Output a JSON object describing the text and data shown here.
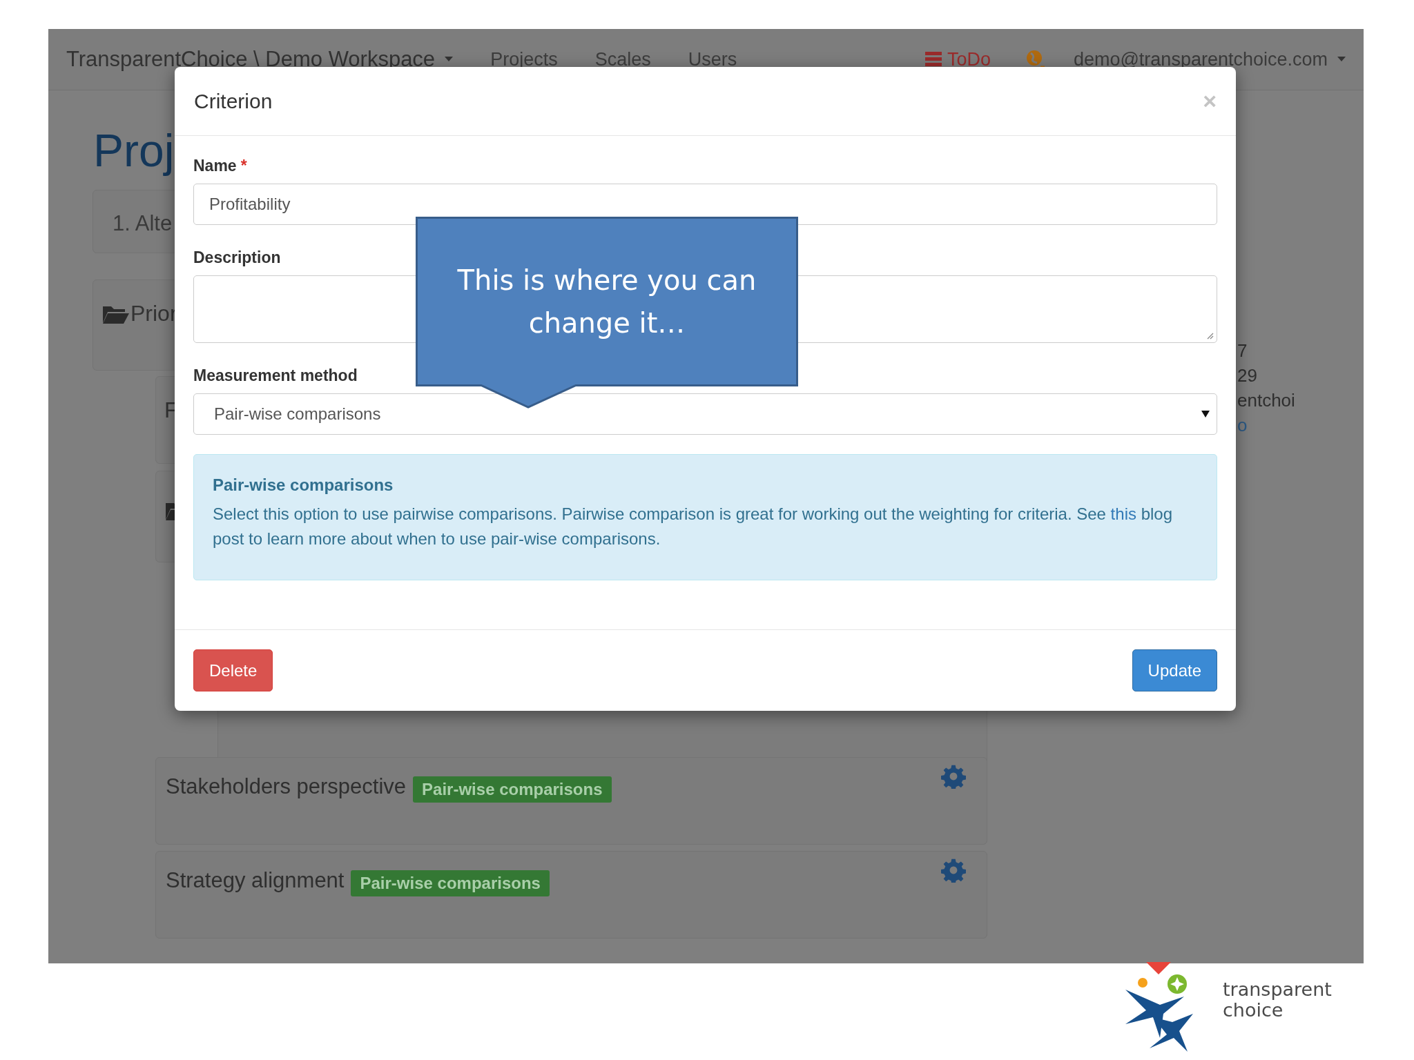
{
  "navbar": {
    "brand": "TransparentChoice \\ Demo Workspace",
    "links": [
      "Projects",
      "Scales",
      "Users"
    ],
    "todo": "ToDo",
    "user": "demo@transparentchoice.com"
  },
  "page": {
    "title": "Proj",
    "step": "1. Alte",
    "folder": "Prior",
    "item": "F",
    "side_fragments": [
      {
        "text": "7",
        "link": false
      },
      {
        "text": "29",
        "link": false
      },
      {
        "text": "entchoi",
        "link": false
      },
      {
        "text": "o",
        "link": true
      }
    ],
    "criteria": [
      {
        "name": "Stakeholders perspective",
        "badge": "Pair-wise comparisons"
      },
      {
        "name": "Strategy alignment",
        "badge": "Pair-wise comparisons"
      }
    ]
  },
  "modal": {
    "title": "Criterion",
    "close": "×",
    "fields": [
      {
        "kind": "text",
        "label": "Name",
        "required_mark": "*",
        "value": "Profitability"
      },
      {
        "kind": "textarea",
        "label": "Description"
      },
      {
        "kind": "select",
        "label": "Measurement method",
        "value": "Pair-wise comparisons"
      }
    ],
    "info": {
      "title": "Pair-wise comparisons",
      "text_before": "Select this option to use pairwise comparisons. Pairwise comparison is great for working out the weighting for criteria. See",
      "link": "this",
      "text_after": "blog post to learn more about when to use pair-wise comparisons."
    },
    "buttons": [
      {
        "kind": "danger",
        "label": "Delete"
      },
      {
        "kind": "primary",
        "label": "Update"
      }
    ]
  },
  "callout": {
    "text": "This is where you can change it…"
  },
  "logo": {
    "line_1": "transparent",
    "line_2": "choice"
  }
}
